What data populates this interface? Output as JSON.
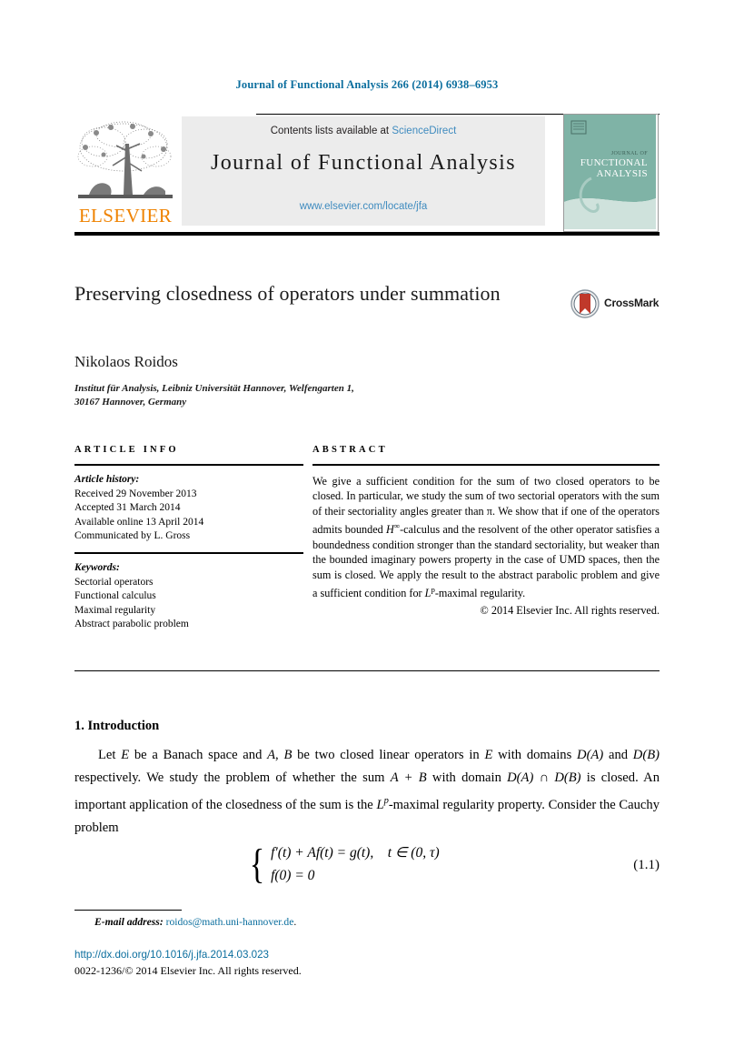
{
  "running_head": "Journal of Functional Analysis 266 (2014) 6938–6953",
  "masthead": {
    "contents_prefix": "Contents lists available at ",
    "sciencedirect": "ScienceDirect",
    "journal_title": "Journal of Functional Analysis",
    "journal_url": "www.elsevier.com/locate/jfa",
    "publisher_name": "ELSEVIER",
    "publisher_color": "#ef8200",
    "link_color": "#3f8bbf",
    "cover_line1": "JOURNAL OF",
    "cover_line2": "FUNCTIONAL",
    "cover_line3": "ANALYSIS",
    "cover_color": "#7fb3a6"
  },
  "article": {
    "title": "Preserving closedness of operators under summation",
    "author": "Nikolaos Roidos",
    "affiliation_line1": "Institut für Analysis, Leibniz Universität Hannover, Welfengarten 1,",
    "affiliation_line2": "30167 Hannover, Germany",
    "crossmark_label": "CrossMark"
  },
  "info": {
    "heading": "ARTICLE INFO",
    "history_label": "Article history:",
    "history": [
      "Received 29 November 2013",
      "Accepted 31 March 2014",
      "Available online 13 April 2014",
      "Communicated by L. Gross"
    ],
    "keywords_label": "Keywords:",
    "keywords": [
      "Sectorial operators",
      "Functional calculus",
      "Maximal regularity",
      "Abstract parabolic problem"
    ]
  },
  "abstract": {
    "heading": "ABSTRACT",
    "text_part1": "We give a sufficient condition for the sum of two closed operators to be closed. In particular, we study the sum of two sectorial operators with the sum of their sectoriality angles greater than π. We show that if one of the operators admits bounded ",
    "h_infinity": "H",
    "h_infinity_sup": "∞",
    "text_part2": "-calculus and the resolvent of the other operator satisfies a boundedness condition stronger than the standard sectoriality, but weaker than the bounded imaginary powers property in the case of UMD spaces, then the sum is closed. We apply the result to the abstract parabolic problem and give a sufficient condition for ",
    "lp": "L",
    "lp_sup": "p",
    "text_part3": "-maximal regularity.",
    "copyright": "© 2014 Elsevier Inc. All rights reserved."
  },
  "section": {
    "number_title": "1.  Introduction",
    "paragraph_p1": "Let ",
    "paragraph_v1": "E",
    "paragraph_p2": " be a Banach space and ",
    "paragraph_v2": "A",
    "paragraph_p3": ", ",
    "paragraph_v3": "B",
    "paragraph_p4": " be two closed linear operators in ",
    "paragraph_v4": "E",
    "paragraph_p5": " with domains ",
    "paragraph_v5": "D(A)",
    "paragraph_p6": " and ",
    "paragraph_v6": "D(B)",
    "paragraph_p7": " respectively. We study the problem of whether the sum ",
    "paragraph_v7": "A + B",
    "paragraph_p8": " with domain ",
    "paragraph_v8": "D(A) ∩ D(B)",
    "paragraph_p9": " is closed. An important application of the closedness of the sum is the ",
    "paragraph_v9": "L",
    "paragraph_v9sup": "p",
    "paragraph_p10": "-maximal regularity property. Consider the Cauchy problem"
  },
  "equation": {
    "line1": "f′(t) + Af(t) = g(t), t ∈ (0, τ)",
    "line2": "f(0) = 0",
    "number": "(1.1)"
  },
  "footer": {
    "email_label": "E-mail address:",
    "email_address": "roidos@math.uni-hannover.de",
    "email_period": ".",
    "doi": "http://dx.doi.org/10.1016/j.jfa.2014.03.023",
    "issn_copyright": "0022-1236/© 2014 Elsevier Inc. All rights reserved."
  }
}
